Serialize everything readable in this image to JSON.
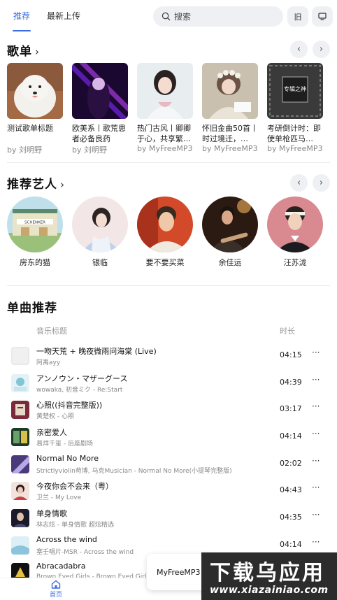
{
  "tabs": [
    {
      "label": "推荐",
      "active": true
    },
    {
      "label": "最新上传",
      "active": false
    }
  ],
  "search": {
    "placeholder": "搜索"
  },
  "top_buttons": {
    "old_label": "旧",
    "screen_icon": "monitor-icon"
  },
  "playlists_section": {
    "title": "歌单",
    "items": [
      {
        "title": "测试歌单标题",
        "by": "by 刘明野",
        "cover": "white-dog"
      },
      {
        "title": "欧美系丨歌荒患者必备良药",
        "by": "by 刘明野",
        "cover": "purple-laser"
      },
      {
        "title": "热门古风丨卿卿于心，共享繁…",
        "by": "by MyFreeMP3",
        "cover": "girl-hanfu"
      },
      {
        "title": "怀旧金曲50首丨时过境迁，…",
        "by": "by MyFreeMP3",
        "cover": "girl-flowers"
      },
      {
        "title": "考研倒计时：即使单枪匹马…",
        "by": "by MyFreeMP3",
        "cover": "dark-box"
      }
    ],
    "cover_text_5": "专辑之神"
  },
  "artists_section": {
    "title": "推荐艺人",
    "items": [
      {
        "name": "房东的猫"
      },
      {
        "name": "银临"
      },
      {
        "name": "要不要买菜"
      },
      {
        "name": "余佳运"
      },
      {
        "name": "汪苏泷"
      }
    ],
    "artist1_sign": "SCHENKER"
  },
  "songs_section": {
    "title": "单曲推荐",
    "col_title": "音乐标题",
    "col_duration": "时长",
    "items": [
      {
        "name": "一吻天荒 + 晚夜微雨问海棠 (Live)",
        "sub": "阿禹ayy",
        "dur": "04:15",
        "more": "···"
      },
      {
        "name": "アンノウン・マザーグース",
        "sub": "wowaka, 初音ミク - Re:Start",
        "dur": "04:39",
        "more": "···"
      },
      {
        "name": "心照((抖音完整版))",
        "sub": "黄楚权 - 心照",
        "dur": "03:17",
        "more": "···"
      },
      {
        "name": "亲密爱人",
        "sub": "易烊千玺 - 后座剧场",
        "dur": "04:14",
        "more": "···"
      },
      {
        "name": "Normal No More",
        "sub": "Strictlyviolin苟博, 马克Musician - Normal No More(小提琴完整版)",
        "dur": "02:02",
        "more": "···"
      },
      {
        "name": "今夜你会不会来（粤）",
        "sub": "卫兰 - My Love",
        "dur": "04:43",
        "more": "···"
      },
      {
        "name": "单身情歌",
        "sub": "林志炫 - 单身情歌 超炫精选",
        "dur": "04:35",
        "more": "···"
      },
      {
        "name": "Across the wind",
        "sub": "塞壬唱片-MSR - Across the wind",
        "dur": "04:14",
        "more": "···"
      },
      {
        "name": "Abracadabra",
        "sub": "Brown Eyed Girls - Brown Eyed Girls",
        "dur": "",
        "more": ""
      }
    ]
  },
  "bottom_nav": {
    "home_label": "首页"
  },
  "mini_player": {
    "label": "MyFreeMP3"
  },
  "watermark": {
    "main": "下载乌应用",
    "url": "www.xiazainiao.com"
  },
  "colors": {
    "accent": "#3a6be0",
    "bg": "#ffffff",
    "muted": "#888888"
  }
}
